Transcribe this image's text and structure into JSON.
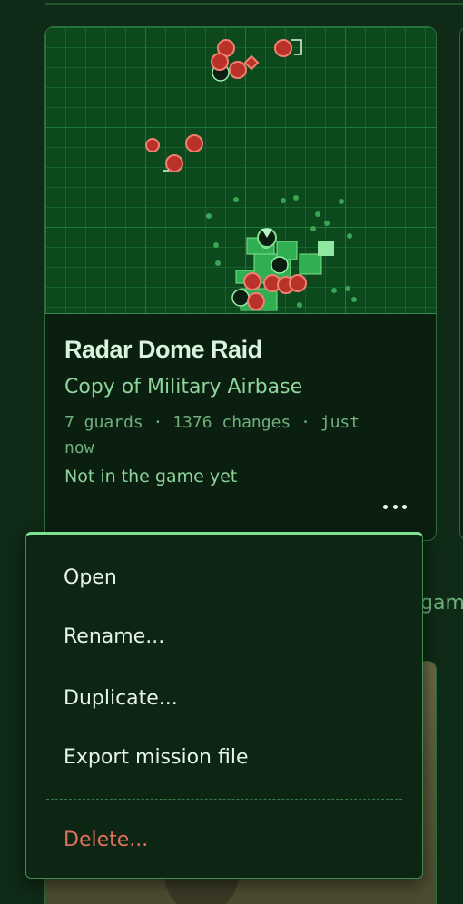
{
  "card": {
    "title": "Radar Dome Raid",
    "subtitle": "Copy of Military Airbase",
    "meta": "7 guards · 1376 changes · just now",
    "status": "Not in the game yet"
  },
  "side_card": {
    "partial_text": "gam"
  },
  "menu": {
    "open": "Open",
    "rename": "Rename...",
    "duplicate": "Duplicate...",
    "export": "Export mission file",
    "delete": "Delete..."
  },
  "colors": {
    "accent": "#7fe08f",
    "danger": "#e0705e",
    "background": "#0f2a16"
  }
}
